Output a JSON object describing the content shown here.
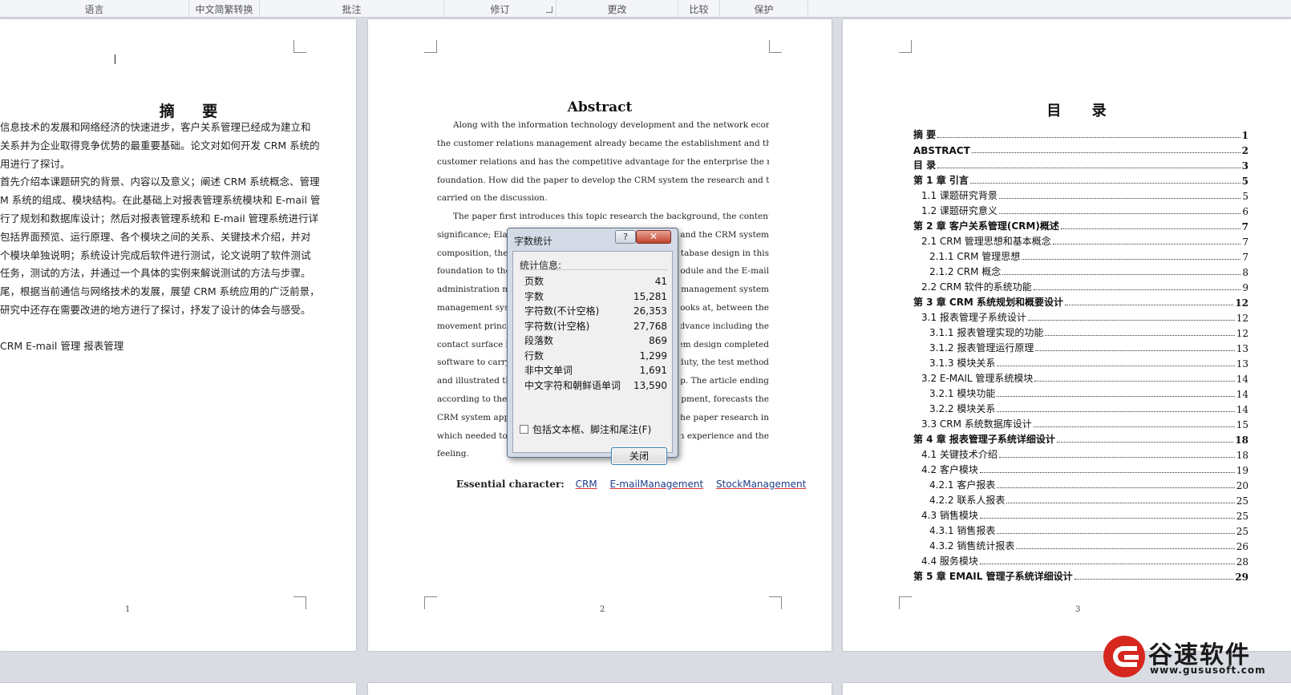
{
  "ribbon": {
    "groups": [
      "语言",
      "中文简繁转换",
      "批注",
      "修订",
      "更改",
      "比较",
      "保护"
    ]
  },
  "page1": {
    "title": "摘  要",
    "lines": [
      "信息技术的发展和网络经济的快速进步，客户关系管理已经成为建立和",
      "关系并为企业取得竞争优势的最重要基础。论文对如何开发 CRM 系统的",
      "用进行了探讨。",
      "首先介绍本课题研究的背景、内容以及意义；阐述 CRM 系统概念、管理",
      "M 系统的组成、模块结构。在此基础上对报表管理系统模块和 E-mail 管",
      "行了规划和数据库设计；然后对报表管理系统和 E-mail 管理系统进行详",
      "包括界面预览、运行原理、各个模块之间的关系、关键技术介绍，并对",
      "个模块单独说明；系统设计完成后软件进行测试，论文说明了软件测试",
      "任务，测试的方法，并通过一个具体的实例来解说测试的方法与步骤。",
      "尾，根据当前通信与网络技术的发展，展望 CRM 系统应用的广泛前景，",
      "研究中还存在需要改进的地方进行了探讨，抒发了设计的体会与感受。"
    ],
    "keywords": "CRM   E-mail 管理   报表管理",
    "page_number": "1"
  },
  "page2": {
    "title": "Abstract",
    "lines": [
      "Along with the information technology development and the network economy fast progress,",
      "the customer relations management already became the establishment and the maintenance",
      "customer relations and has the competitive advantage for the enterprise the most important",
      "foundation. How did the paper to develop the CRM system the research and the application has",
      "carried on the discussion.",
      "The paper first introduces this topic research the background, the content as well as the",
      "significance; Elabora",
      "composition, the mo",
      "foundation to the re",
      "administration modu",
      "management system",
      "movement principle,",
      "contact surface intro",
      "software to carry on",
      "and illustrated the te",
      "according to the cur",
      "CRM system applica",
      "which needed to im",
      "feeling."
    ],
    "right_fragments": [
      "ught and the CRM system",
      "e database design in this",
      "m module and the E-mail",
      "form management system",
      "stem, looks at, between the",
      "in advance including the",
      "e system design completed",
      "and the duty, the test method,",
      "e step. The article ending,",
      "development, forecasts the",
      "ce to the paper research in",
      "design experience and the"
    ],
    "essential_label": "Essential character:",
    "keywords": [
      "CRM",
      "E-mailManagement",
      "StockManagement"
    ],
    "page_number": "2"
  },
  "page3": {
    "title": "目  录",
    "toc": [
      {
        "label": "摘  要",
        "page": "1",
        "level": 1
      },
      {
        "label": "ABSTRACT",
        "page": "2",
        "level": 1
      },
      {
        "label": "目  录",
        "page": "3",
        "level": 1
      },
      {
        "label": "第 1 章   引言",
        "page": "5",
        "level": 1
      },
      {
        "label": "1.1  课题研究背景",
        "page": "5",
        "level": 2
      },
      {
        "label": "1.2  课题研究意义",
        "page": "6",
        "level": 2
      },
      {
        "label": "第 2 章   客户关系管理(CRM)概述",
        "page": "7",
        "level": 1
      },
      {
        "label": "2.1  CRM 管理思想和基本概念",
        "page": "7",
        "level": 2
      },
      {
        "label": "2.1.1   CRM 管理思想",
        "page": "7",
        "level": 3
      },
      {
        "label": "2.1.2   CRM 概念",
        "page": "8",
        "level": 3
      },
      {
        "label": "2.2  CRM 软件的系统功能",
        "page": "9",
        "level": 2
      },
      {
        "label": "第 3 章   CRM 系统规划和概要设计",
        "page": "12",
        "level": 1
      },
      {
        "label": "3.1  报表管理子系统设计",
        "page": "12",
        "level": 2
      },
      {
        "label": "3.1.1   报表管理实现的功能",
        "page": "12",
        "level": 3
      },
      {
        "label": "3.1.2   报表管理运行原理",
        "page": "13",
        "level": 3
      },
      {
        "label": "3.1.3   模块关系",
        "page": "13",
        "level": 3
      },
      {
        "label": "3.2  E-MAIL 管理系统模块",
        "page": "14",
        "level": 2
      },
      {
        "label": "3.2.1   模块功能",
        "page": "14",
        "level": 3
      },
      {
        "label": "3.2.2   模块关系",
        "page": "14",
        "level": 3
      },
      {
        "label": "3.3  CRM 系统数据库设计",
        "page": "15",
        "level": 2
      },
      {
        "label": "第 4 章   报表管理子系统详细设计",
        "page": "18",
        "level": 1
      },
      {
        "label": "4.1  关键技术介绍",
        "page": "18",
        "level": 2
      },
      {
        "label": "4.2  客户模块",
        "page": "19",
        "level": 2
      },
      {
        "label": "4.2.1   客户报表",
        "page": "20",
        "level": 3
      },
      {
        "label": "4.2.2   联系人报表",
        "page": "25",
        "level": 3
      },
      {
        "label": "4.3 销售模块",
        "page": "25",
        "level": 2
      },
      {
        "label": "4.3.1 销售报表",
        "page": "25",
        "level": 3
      },
      {
        "label": "4.3.2   销售统计报表",
        "page": "26",
        "level": 3
      },
      {
        "label": "4.4  服务模块",
        "page": "28",
        "level": 2
      },
      {
        "label": "第 5 章   EMAIL 管理子系统详细设计",
        "page": "29",
        "level": 1
      }
    ],
    "page_number": "3"
  },
  "dialog": {
    "title": "字数统计",
    "help_label": "?",
    "close_x": "✕",
    "group_label": "统计信息:",
    "stats": [
      {
        "label": "页数",
        "value": "41"
      },
      {
        "label": "字数",
        "value": "15,281"
      },
      {
        "label": "字符数(不计空格)",
        "value": "26,353"
      },
      {
        "label": "字符数(计空格)",
        "value": "27,768"
      },
      {
        "label": "段落数",
        "value": "869"
      },
      {
        "label": "行数",
        "value": "1,299"
      },
      {
        "label": "非中文单词",
        "value": "1,691"
      },
      {
        "label": "中文字符和朝鲜语单词",
        "value": "13,590"
      }
    ],
    "checkbox_label": "包括文本框、脚注和尾注(F)",
    "checkbox_checked": false,
    "close_button": "关闭"
  },
  "watermark": {
    "brand": "谷速软件",
    "url": "www.gususoft.com",
    "color": "#d6271f"
  }
}
